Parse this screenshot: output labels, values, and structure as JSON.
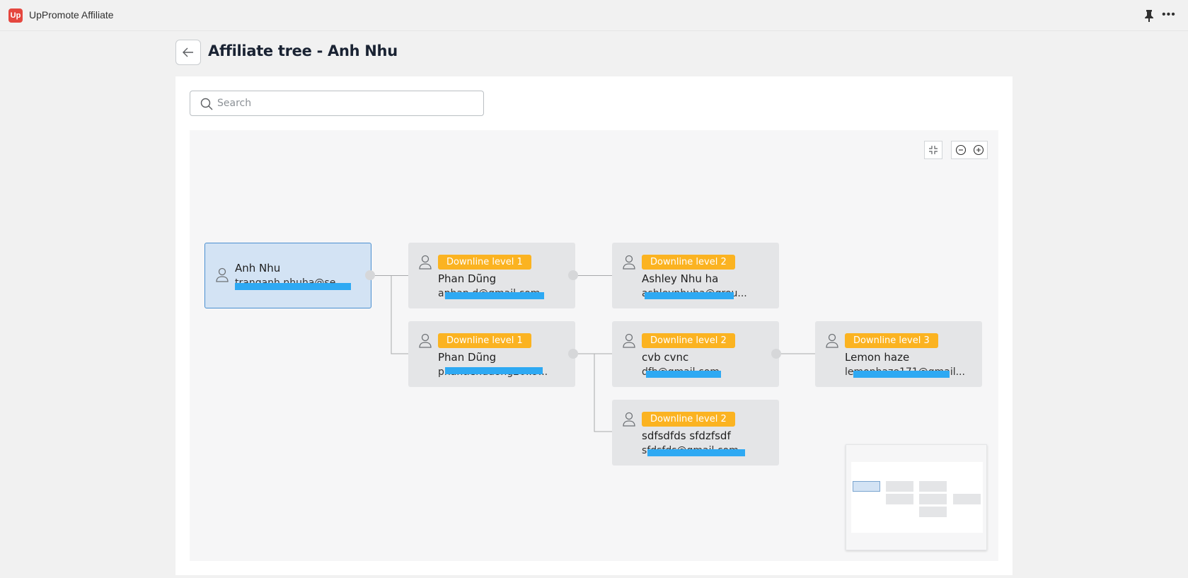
{
  "app": {
    "title": "UpPromote Affiliate",
    "logo_text": "Up"
  },
  "header": {
    "back_label": "Back",
    "title": "Affiliate tree - Anh Nhu"
  },
  "search": {
    "placeholder": "Search",
    "value": ""
  },
  "controls": {
    "fit_label": "Fit to view",
    "zoom_out_label": "Zoom out",
    "zoom_in_label": "Zoom in"
  },
  "tree": {
    "root": {
      "name": "Anh Nhu",
      "email": "tranganh.nhuha@se..."
    },
    "nodes": [
      {
        "level_label": "Downline level 1",
        "name": "Phan Dũng",
        "email": "aphan.d@gmail.com"
      },
      {
        "level_label": "Downline level 2",
        "name": "Ashley Nhu ha",
        "email": "ashleynhuha@grou..."
      },
      {
        "level_label": "Downline level 1",
        "name": "Phan Dũng",
        "email": "phantienduong20..9..."
      },
      {
        "level_label": "Downline level 2",
        "name": "cvb cvnc",
        "email": "dfh@gmail.com"
      },
      {
        "level_label": "Downline level 3",
        "name": "Lemon haze",
        "email": "lemonhaze171@gmail..."
      },
      {
        "level_label": "Downline level 2",
        "name": "sdfsdfds sfdzfsdf",
        "email": "sfdsfds@gmail.com"
      }
    ]
  },
  "colors": {
    "badge": "#fbb321",
    "root_fill": "#d3e3f4",
    "root_border": "#4a8fd0",
    "node_fill": "#e4e5e7",
    "redaction": "#2ea9f3",
    "logo": "#e5473f"
  }
}
